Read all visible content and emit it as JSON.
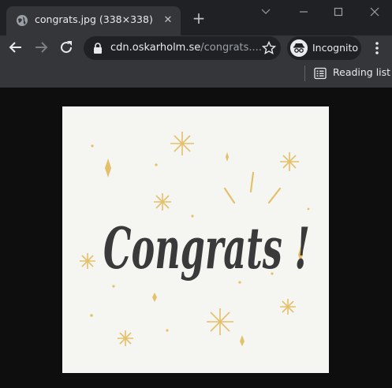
{
  "tab": {
    "title": "congrats.jpg (338×338)",
    "favicon": "globe-icon",
    "close_icon": "close-icon"
  },
  "new_tab_icon": "plus-icon",
  "window_controls": [
    "chevron-down-icon",
    "minimize-icon",
    "maximize-icon",
    "close-icon"
  ],
  "toolbar": {
    "back_icon": "arrow-left-icon",
    "forward_icon": "arrow-right-icon",
    "reload_icon": "reload-icon",
    "url_host": "cdn.oskarholm.se",
    "url_path": "/congrats....",
    "bookmark_icon": "star-icon",
    "profile_label": "Incognito",
    "menu_icon": "kebab-menu-icon"
  },
  "bookmarks_bar": {
    "reading_list_label": "Reading list",
    "reading_list_icon": "reading-list-icon"
  },
  "content": {
    "image_text": "Congrats !",
    "image_background": "#f5f5f2",
    "ink_color": "#3a3a3a",
    "accent_color": "#e5c06a"
  },
  "colors": {
    "tabstrip": "#202124",
    "toolbar": "#35363a",
    "page": "#0e0e0e"
  }
}
